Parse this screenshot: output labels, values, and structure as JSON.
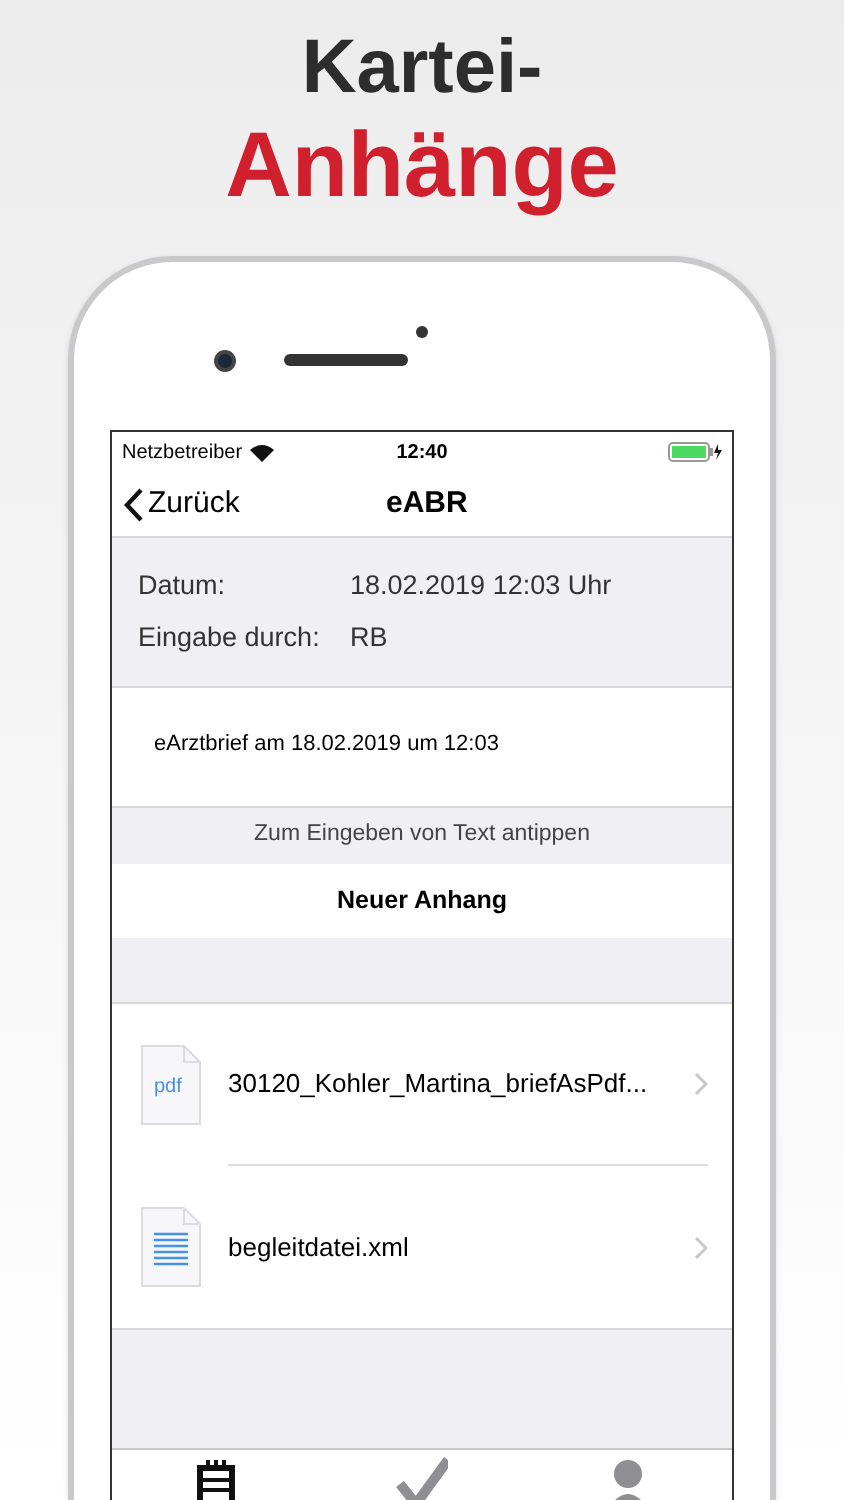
{
  "headline": {
    "line_1": "Kartei-",
    "line_2": "Anhänge"
  },
  "status_bar": {
    "carrier": "Netzbetreiber",
    "time": "12:40"
  },
  "nav_bar": {
    "back": "Zurück",
    "title": "eABR"
  },
  "details": [
    {
      "label": "Datum:",
      "value": "18.02.2019 12:03 Uhr"
    },
    {
      "label": "Eingabe durch:",
      "value": "RB"
    }
  ],
  "note": "eArztbrief am 18.02.2019 um 12:03",
  "hint": "Zum Eingeben von Text antippen",
  "new_attachment_button": "Neuer Anhang",
  "attachments": [
    {
      "kind": "pdf",
      "icon_text": "pdf",
      "name": "30120_Kohler_Martina_briefAsPdf..."
    },
    {
      "kind": "xml",
      "name": "begleitdatei.xml"
    }
  ],
  "tab_bar": [
    {
      "kind": "notes",
      "selected": true
    },
    {
      "kind": "check",
      "selected": false
    },
    {
      "kind": "person",
      "selected": false
    }
  ]
}
